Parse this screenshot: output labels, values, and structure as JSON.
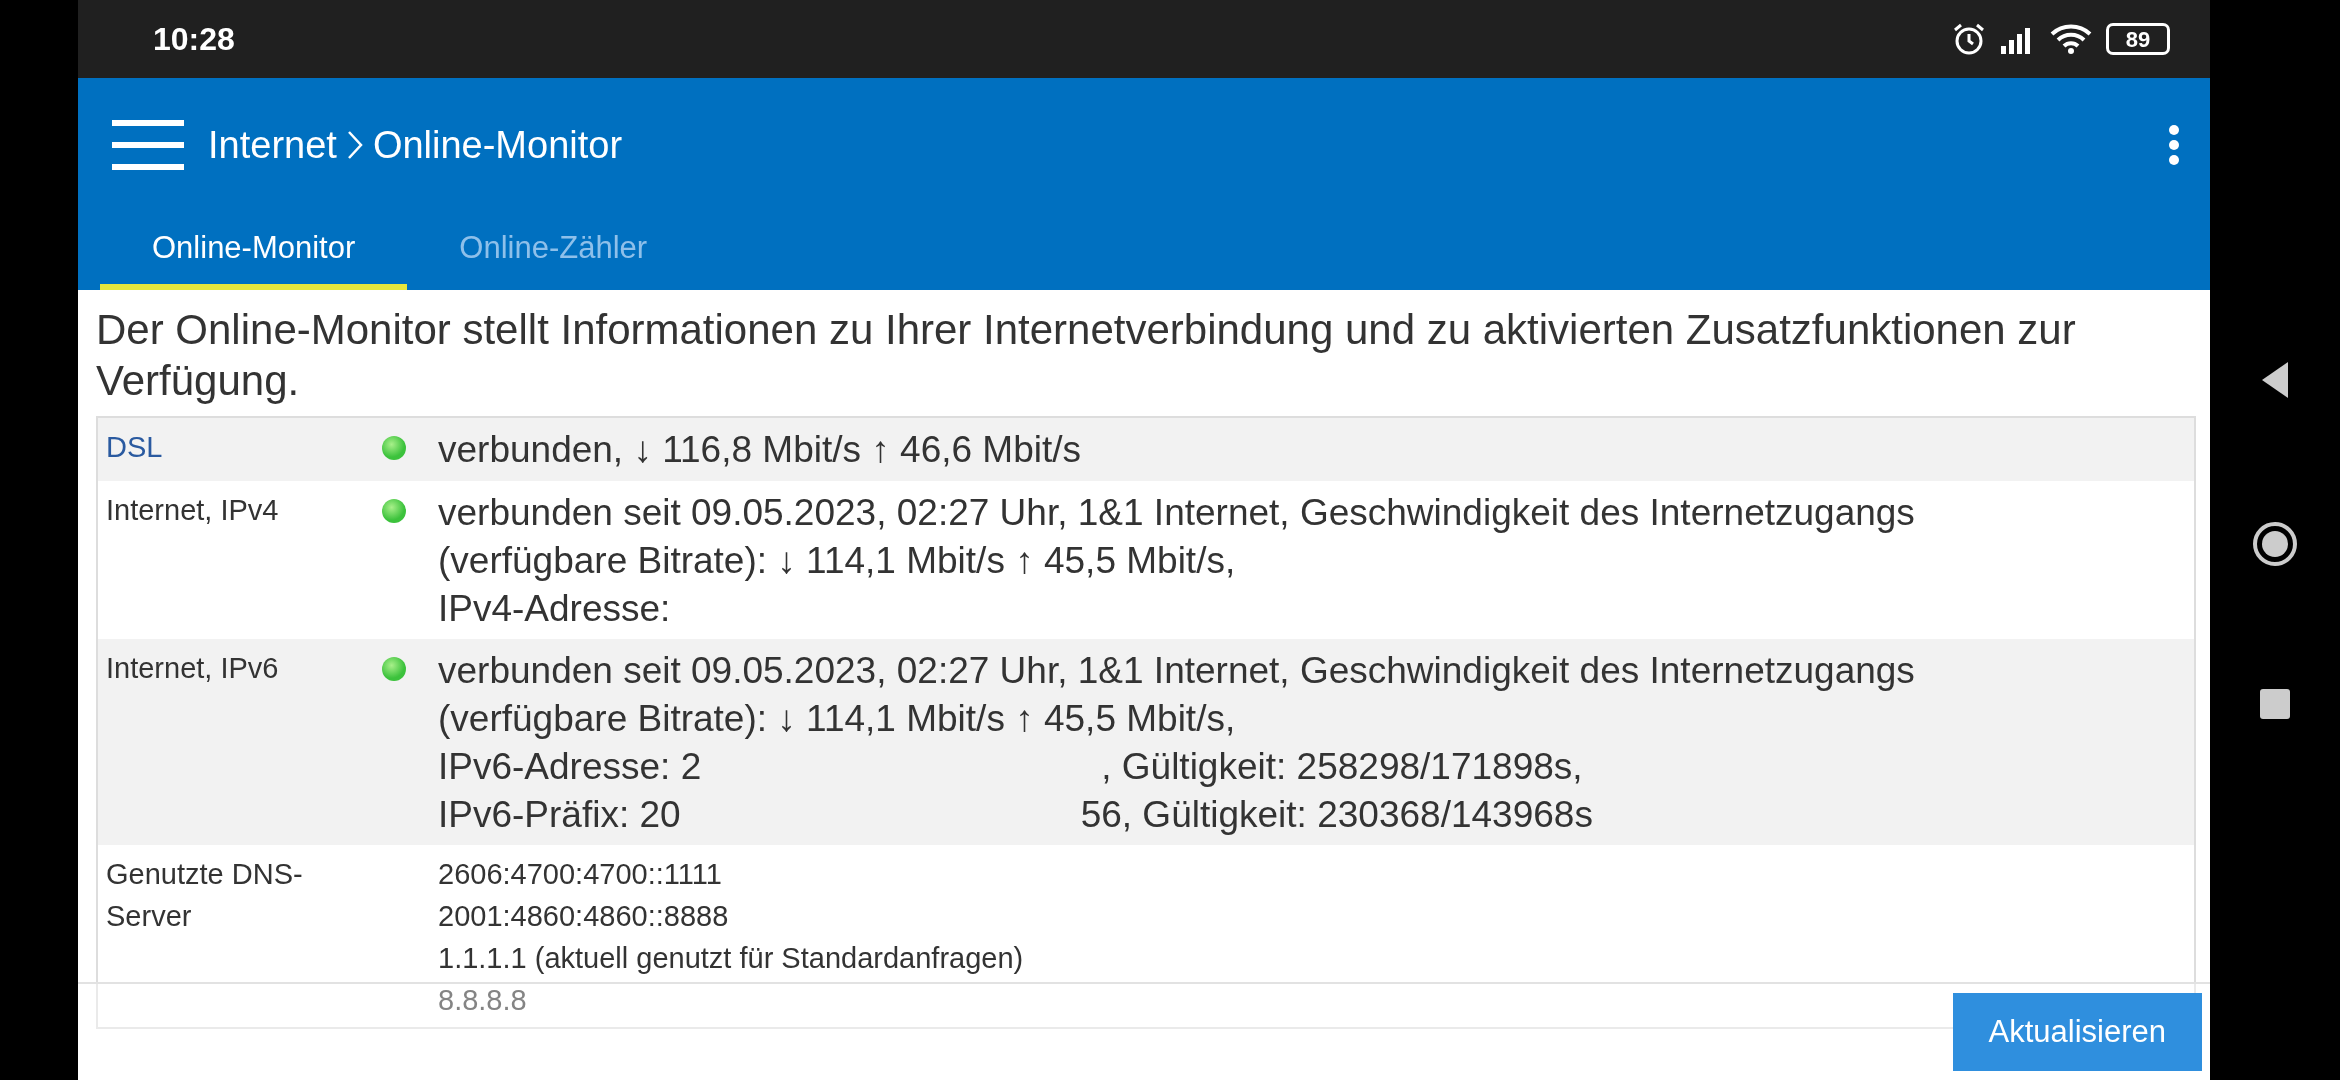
{
  "status_bar": {
    "time": "10:28",
    "battery": "89"
  },
  "app_bar": {
    "breadcrumb": [
      {
        "label": "Internet"
      },
      {
        "label": "Online-Monitor"
      }
    ]
  },
  "tabs": [
    {
      "label": "Online-Monitor",
      "selected": true
    },
    {
      "label": "Online-Zähler",
      "selected": false
    }
  ],
  "intro": "Der Online-Monitor stellt Informationen zu Ihrer Internetverbindung und zu aktivierten Zusatzfunktionen zur Verfügung.",
  "rows": [
    {
      "label": "DSL",
      "link": true,
      "connected": true,
      "lines": [
        {
          "text": "verbunden, ↓ 116,8 Mbit/s ↑ 46,6 Mbit/s"
        }
      ]
    },
    {
      "label": "Internet, IPv4",
      "link": false,
      "connected": true,
      "lines": [
        {
          "text": "verbunden seit 09.05.2023, 02:27 Uhr, 1&1 Internet, Geschwindigkeit des Internetzugangs (verfügbare Bitrate): ↓ 114,1 Mbit/s ↑ 45,5 Mbit/s,"
        },
        {
          "text": "IPv4-Adresse:"
        }
      ]
    },
    {
      "label": "Internet, IPv6",
      "link": false,
      "connected": true,
      "lines": [
        {
          "text": "verbunden seit 09.05.2023, 02:27 Uhr, 1&1 Internet, Geschwindigkeit des Internetzugangs (verfügbare Bitrate): ↓ 114,1 Mbit/s ↑ 45,5 Mbit/s,"
        },
        {
          "text": "IPv6-Adresse: 2",
          "after": ", Gültigkeit: 258298/171898s,"
        },
        {
          "text": "IPv6-Präfix: 20",
          "after": "56, Gültigkeit: 230368/143968s"
        }
      ]
    },
    {
      "label": "Genutzte DNS-Server",
      "link": false,
      "small": true,
      "lines": [
        {
          "text": "2606:4700:4700::1111"
        },
        {
          "text": "2001:4860:4860::8888"
        },
        {
          "text": "1.1.1.1 (aktuell genutzt für Standardanfragen)"
        },
        {
          "text": "8.8.8.8"
        }
      ]
    }
  ],
  "refresh_button": "Aktualisieren"
}
